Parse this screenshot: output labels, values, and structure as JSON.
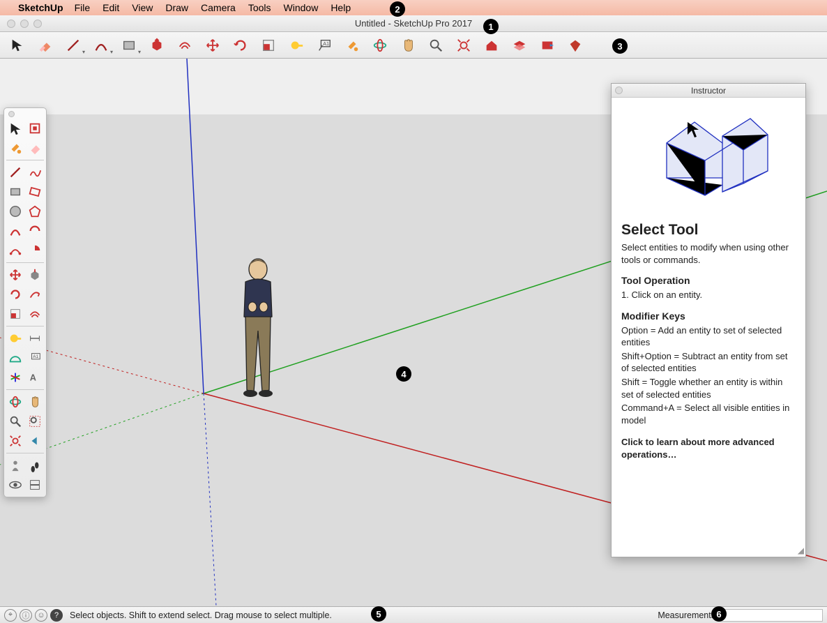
{
  "menubar": {
    "app_name": "SketchUp",
    "items": [
      "File",
      "Edit",
      "View",
      "Draw",
      "Camera",
      "Tools",
      "Window",
      "Help"
    ]
  },
  "window": {
    "title": "Untitled - SketchUp Pro 2017"
  },
  "toolbar_top": [
    "select-icon",
    "eraser-icon",
    "line-icon",
    "arc-icon",
    "rectangle-icon",
    "pushpull-icon",
    "offset-icon",
    "move-icon",
    "rotate-icon",
    "scale-icon",
    "tape-icon",
    "text-icon",
    "paint-icon",
    "orbit-icon",
    "pan-icon",
    "zoom-icon",
    "zoom-extents-icon",
    "warehouse-icon",
    "layers-icon",
    "extensions-icon",
    "ruby-icon"
  ],
  "palette_groups": [
    [
      "select-icon",
      "make-component-icon"
    ],
    [
      "paint-icon",
      "eraser-icon"
    ],
    [
      "hr"
    ],
    [
      "line-icon",
      "freehand-icon"
    ],
    [
      "rectangle-icon",
      "rotated-rect-icon"
    ],
    [
      "circle-icon",
      "polygon-icon"
    ],
    [
      "arc-icon",
      "arc2-icon"
    ],
    [
      "arc3-icon",
      "pie-icon"
    ],
    [
      "hr"
    ],
    [
      "move-icon",
      "pushpull-icon"
    ],
    [
      "rotate-icon",
      "followme-icon"
    ],
    [
      "scale-icon",
      "offset-icon"
    ],
    [
      "hr"
    ],
    [
      "tape-icon",
      "dimension-icon"
    ],
    [
      "protractor-icon",
      "text-icon"
    ],
    [
      "axes-icon",
      "3dtext-icon"
    ],
    [
      "hr"
    ],
    [
      "orbit-icon",
      "pan-icon"
    ],
    [
      "zoom-icon",
      "zoom-window-icon"
    ],
    [
      "zoom-extents-icon",
      "previous-icon"
    ],
    [
      "hr"
    ],
    [
      "position-camera-icon",
      "walk-icon"
    ],
    [
      "look-icon",
      "section-icon"
    ]
  ],
  "instructor": {
    "panel_title": "Instructor",
    "heading": "Select Tool",
    "subtitle": "Select entities to modify when using other tools or commands.",
    "op_head": "Tool Operation",
    "op_text": "1. Click on an entity.",
    "mod_head": "Modifier Keys",
    "mod_lines": [
      "Option = Add an entity to set of selected entities",
      "Shift+Option = Subtract an entity from set of selected entities",
      "Shift = Toggle whether an entity is within set of selected entities",
      "Command+A = Select all visible entities in model"
    ],
    "learn_more": "Click to learn about more advanced operations…"
  },
  "status": {
    "hint": "Select objects. Shift to extend select. Drag mouse to select multiple.",
    "measurements_label": "Measurements",
    "measurements_value": ""
  },
  "badges": [
    "1",
    "2",
    "3",
    "4",
    "5",
    "6"
  ],
  "colors": {
    "axis_x": "#c02020",
    "axis_y": "#20a020",
    "axis_z": "#2030c0"
  }
}
